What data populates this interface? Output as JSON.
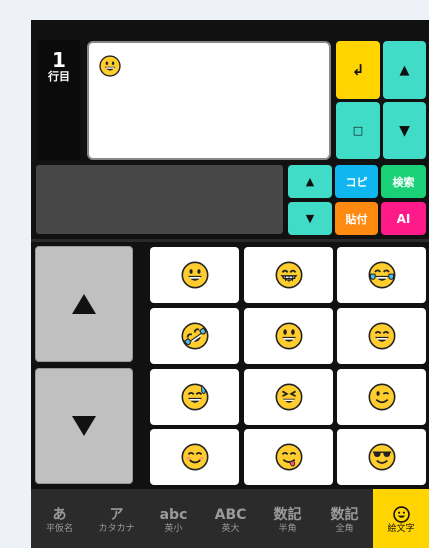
{
  "editor": {
    "line_number": "1",
    "line_unit": "行目",
    "content_emoji": "grinning-face"
  },
  "buttons": {
    "enter": "↲",
    "cursor_up": "▲",
    "space": "□",
    "cursor_down": "▼",
    "scroll_up": "▲",
    "scroll_down": "▼",
    "copy": "コピ",
    "search": "検索",
    "paste": "貼付",
    "ai": "AI"
  },
  "emoji_grid": [
    "grinning-face",
    "grinning-face-with-smiling-eyes",
    "face-with-tears-of-joy",
    "rolling-on-the-floor-laughing",
    "grinning-face-with-big-eyes",
    "smiling-face-with-open-mouth-and-smiling-eyes",
    "grinning-face-with-sweat",
    "grinning-squinting-face",
    "winking-face",
    "smiling-face-with-smiling-eyes",
    "face-savoring-food",
    "smiling-face-with-sunglasses"
  ],
  "page_buttons": {
    "up": "▲",
    "down": "▼"
  },
  "tabs": [
    {
      "main": "あ",
      "sub": "平仮名"
    },
    {
      "main": "ア",
      "sub": "カタカナ"
    },
    {
      "main": "abc",
      "sub": "英小"
    },
    {
      "main": "ABC",
      "sub": "英大"
    },
    {
      "main": "数記",
      "sub": "半角"
    },
    {
      "main": "数記",
      "sub": "全角"
    },
    {
      "main": "",
      "sub": "絵文字"
    }
  ],
  "colors": {
    "accent_yellow": "#ffd400",
    "teal": "#40dcc8",
    "blue": "#10b6ef",
    "green": "#1ad178",
    "orange": "#ff8a12",
    "pink": "#ff1a8a"
  }
}
